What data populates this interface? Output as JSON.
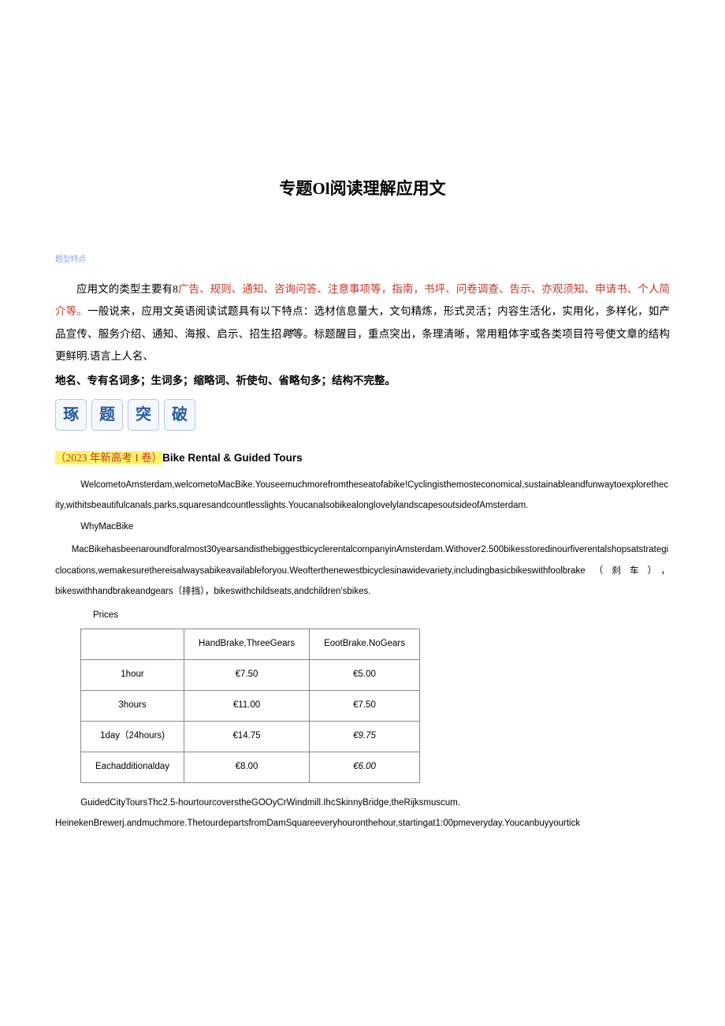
{
  "title": "专题Ol阅读理解应用文",
  "small_label": "题型特点",
  "intro": {
    "seg1": "应用文的类型主要有8",
    "seg2_red": "广告、规则、通知、咨询问答、注意事项等，指南，书坪、问卷调查、告示、亦观须知、申请书、个人简介等。",
    "seg3": "一般说来，应用文英语阅读试题具有以下特点：选材信息量大，文句精炼，形式灵活；内容生活化，实用化，多样化，如产品宣传、服务介绍、通知、海报、启示、招生招",
    "seg4_italic": "聘",
    "seg5": "等。标题醒目，重点突出，条理清晰，常用粗体字或各类项目符号使文章的结构更鲜明.语言上人名、"
  },
  "bold_list": "地名、专有名词多；生词多；缩略词、祈使句、省略句多；结构不完整。",
  "badges": [
    "琢",
    "题",
    "突",
    "破"
  ],
  "source": {
    "tag": "（2023 年新高考 I 卷）",
    "eng": "Bike Rental & Guided Tours"
  },
  "para1": "WelcometoAmsterdam,welcometoMacBike.Youseemuchmorefromtheseatofabike!Cyclingisthemosteconomical,sustainableandfunwaytoexplorethecity,withitsbeautifulcanals,parks,squaresandcountlesslights.YoucanalsobikealonglovelylandscapesoutsideofAmsterdam.",
  "subhead1": "WhyMacBike",
  "para2": "MacBikehasbeenaroundforalmost30yearsandisthebiggestbicyclerentalcompanyinAmsterdam.Withover2.500bikesstoredinourfiverentalshopsatstrategiclocations,wemakesurethereisalwaysabikeavailableforyou.Weofterthenewestbicyclesinawidevariety,includingbasicbikeswithfoolbrake（刹车），bikeswithhandbrakeandgears（排挡），bikeswithchildseats,andchildren'sbikes.",
  "prices_label": "Prices",
  "table": {
    "head": [
      "",
      "HandBrake,ThreeGears",
      "EootBrake.NoGears"
    ],
    "rows": [
      [
        "1hour",
        "€7.50",
        "€5.00"
      ],
      [
        "3hours",
        "€11.00",
        "€7.50"
      ],
      [
        "1day（24hours)",
        "€14.75",
        "€9.75"
      ],
      [
        "Eachadditionalday",
        "€8.00",
        "€6.00"
      ]
    ]
  },
  "para3": "GuidedCityToursThc2.5-hourtourcoverstheGOOyCrWindmill.IhcSkinnyBridge,theRijksmuscum.",
  "para4": "HeinekenBrewerj.andmuchmore.ThetourdepartsfromDamSquareeveryhouronthehour,startingat1:00pmeveryday.Youcanbuyyourtick"
}
